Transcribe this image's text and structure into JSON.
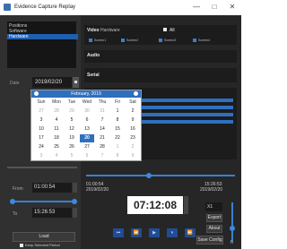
{
  "window": {
    "title": "Evidence Capture Replay",
    "controls": [
      "—",
      "□",
      "✕"
    ]
  },
  "tree": {
    "items": [
      "Positions",
      "Software",
      "Hardware"
    ],
    "selected_index": 2
  },
  "date": {
    "label": "Date",
    "value": "2019/02/20"
  },
  "calendar": {
    "month_label": "February, 2019",
    "weekdays": [
      "Sun",
      "Mon",
      "Tue",
      "Wed",
      "Thu",
      "Fri",
      "Sat"
    ],
    "weeks": [
      [
        "27",
        "28",
        "29",
        "30",
        "31",
        "1",
        "2"
      ],
      [
        "3",
        "4",
        "5",
        "6",
        "7",
        "8",
        "9"
      ],
      [
        "10",
        "11",
        "12",
        "13",
        "14",
        "15",
        "16"
      ],
      [
        "17",
        "18",
        "19",
        "20",
        "21",
        "22",
        "23"
      ],
      [
        "24",
        "25",
        "26",
        "27",
        "28",
        "1",
        "2"
      ],
      [
        "3",
        "4",
        "5",
        "6",
        "7",
        "8",
        "9"
      ]
    ],
    "selected_day": "20"
  },
  "video": {
    "label": "Video",
    "source": "Hardware",
    "all_label": "All",
    "screens": [
      "Screen1",
      "Screen2",
      "Screen3",
      "Screen4"
    ]
  },
  "audio": {
    "label": "Audio"
  },
  "serial": {
    "label": "Serial"
  },
  "timeline": {
    "start_time": "01:00:54",
    "start_date": "2019/02/20",
    "end_time": "15:26:53",
    "end_date": "2019/02/20",
    "current_time": "07:12:08"
  },
  "range": {
    "from_label": "From",
    "from_value": "01:00:54",
    "to_label": "To",
    "to_value": "15:26:53"
  },
  "actions": {
    "load": "Load",
    "keep_selected": "Keep Selected Period",
    "export": "Export",
    "about": "About",
    "save_config": "Save Config",
    "speed": "X1",
    "slider_letter": "h"
  },
  "playback": [
    "⏮",
    "⏪",
    "▶",
    "⏸",
    "⏩"
  ]
}
